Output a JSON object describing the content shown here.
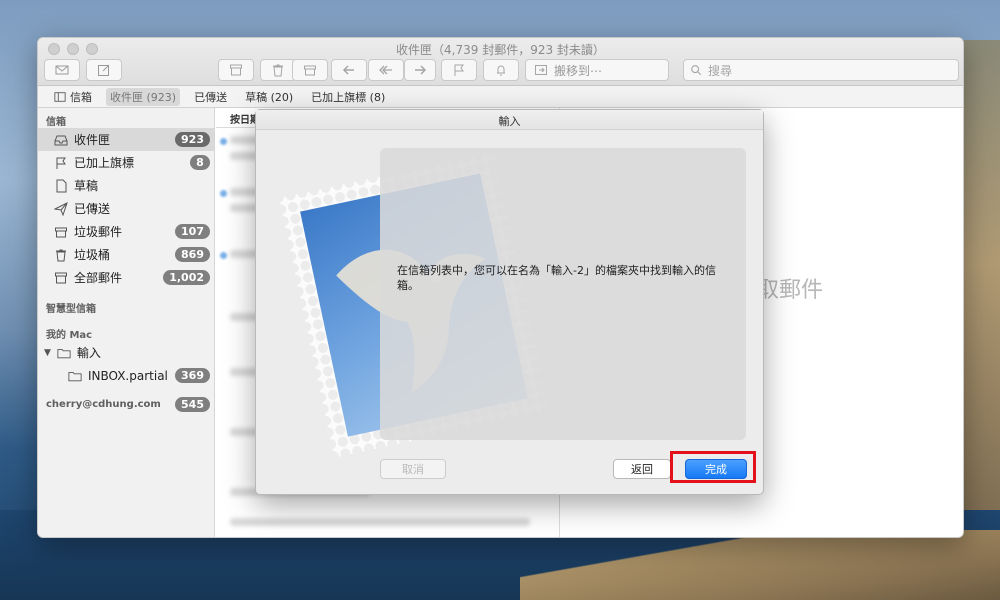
{
  "window": {
    "title": "收件匣（4,739 封郵件，923 封未讀）"
  },
  "toolbar": {
    "move_to_label": "搬移到⋯",
    "search_placeholder": "搜尋"
  },
  "favorites": [
    {
      "label": "信箱"
    },
    {
      "label": "收件匣 (923)"
    },
    {
      "label": "已傳送"
    },
    {
      "label": "草稿 (20)"
    },
    {
      "label": "已加上旗標 (8)"
    }
  ],
  "sidebar": {
    "mailboxes_header": "信箱",
    "items": [
      {
        "label": "收件匣",
        "badge": "923",
        "icon": "inbox-icon"
      },
      {
        "label": "已加上旗標",
        "badge": "8",
        "icon": "flag-icon"
      },
      {
        "label": "草稿",
        "badge": "",
        "icon": "document-icon"
      },
      {
        "label": "已傳送",
        "badge": "",
        "icon": "paper-plane-icon"
      },
      {
        "label": "垃圾郵件",
        "badge": "107",
        "icon": "junk-icon"
      },
      {
        "label": "垃圾桶",
        "badge": "869",
        "icon": "trash-icon"
      },
      {
        "label": "全部郵件",
        "badge": "1,002",
        "icon": "archive-icon"
      }
    ],
    "smart_header": "智慧型信箱",
    "mac_header": "我的 Mac",
    "import_folder": "輸入",
    "inbox_partial": {
      "label": "INBOX.partial",
      "badge": "369"
    },
    "account": {
      "label": "cherry@cdhung.com",
      "badge": "545"
    }
  },
  "message_list": {
    "sort_label": "按日期"
  },
  "preview": {
    "empty_text": "未選取郵件"
  },
  "dialog": {
    "title": "輸入",
    "message": "在信箱列表中，您可以在名為「輸入-2」的檔案夾中找到輸入的信箱。",
    "cancel_label": "取消",
    "back_label": "返回",
    "done_label": "完成"
  },
  "colors": {
    "accent": "#1679f5",
    "highlight": "#e3111a"
  }
}
